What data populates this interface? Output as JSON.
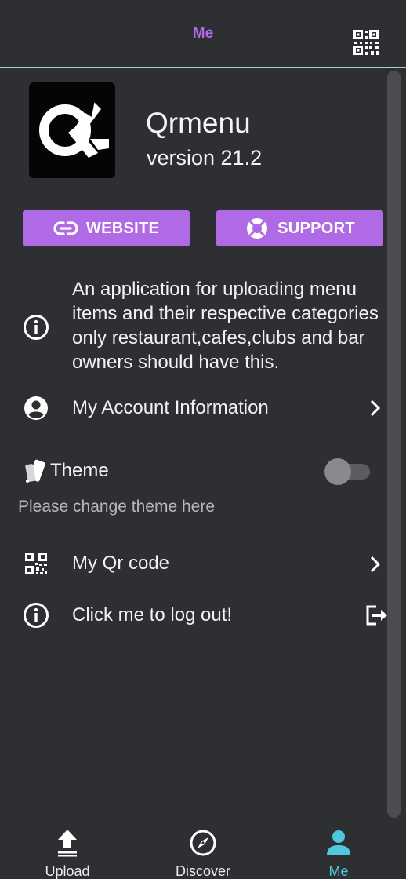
{
  "header": {
    "title": "Me",
    "qr_icon": "qr-code-icon"
  },
  "app": {
    "name": "Qrmenu",
    "version": "version 21.2",
    "logo_icon": "qrmenu-logo"
  },
  "buttons": {
    "website": {
      "label": "WEBSITE",
      "icon": "link-icon"
    },
    "support": {
      "label": "SUPPORT",
      "icon": "lifebuoy-icon"
    }
  },
  "info": {
    "icon": "info-icon",
    "description": "An application for uploading menu items and their respective categories only restaurant,cafes,clubs and bar owners should have this."
  },
  "menu": {
    "account": {
      "label": "My Account Information",
      "icon": "account-circle-icon"
    },
    "theme": {
      "label": "Theme",
      "subtitle": "Please change theme here",
      "icon": "palette-cards-icon",
      "enabled": false
    },
    "qrcode": {
      "label": "My Qr code",
      "icon": "qr-code-icon"
    },
    "logout": {
      "label": "Click me to log out!",
      "icon": "info-icon",
      "action_icon": "logout-icon"
    }
  },
  "bottom_nav": [
    {
      "label": "Upload",
      "icon": "upload-icon",
      "active": false
    },
    {
      "label": "Discover",
      "icon": "compass-icon",
      "active": false
    },
    {
      "label": "Me",
      "icon": "person-icon",
      "active": true
    }
  ],
  "colors": {
    "background": "#2e2f33",
    "accent": "#b06ae6",
    "active_tab": "#4fc8dc",
    "header_divider": "#a9c9d6"
  }
}
